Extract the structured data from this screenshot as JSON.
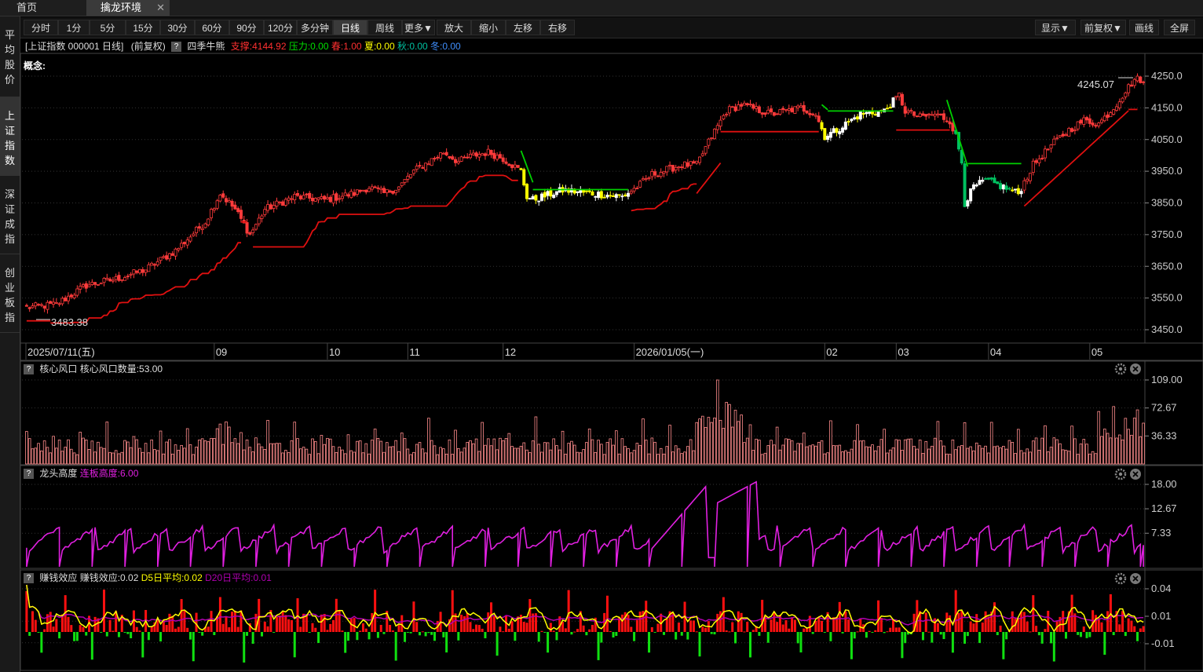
{
  "tabs": {
    "home": "首页",
    "active": "擒龙环境",
    "close": "✕"
  },
  "sidebar": [
    {
      "label": "平均股价",
      "active": false
    },
    {
      "label": "上证指数",
      "active": true
    },
    {
      "label": "深证成指",
      "active": false
    },
    {
      "label": "创业板指",
      "active": false
    }
  ],
  "toolbar": {
    "periods": [
      "分时",
      "1分",
      "5分",
      "15分",
      "30分",
      "60分",
      "90分",
      "120分",
      "多分钟",
      "日线",
      "周线",
      "更多▼",
      "放大",
      "缩小",
      "左移",
      "右移"
    ],
    "active_period": "日线",
    "right": [
      "显示▼",
      "前复权▼",
      "画线",
      "全屏"
    ]
  },
  "info": {
    "title": "[上证指数 000001 日线]",
    "adjust": "(前复权)",
    "indicator": "四季牛熊",
    "support": "支撑:4144.92",
    "pressure": "压力:0.00",
    "spring": "春:1.00",
    "summer": "夏:0.00",
    "autumn": "秋:0.00",
    "winter": "冬:0.00",
    "concept": "概念:",
    "colors": {
      "support": "#ff3030",
      "pressure": "#00e000",
      "spring": "#ff3030",
      "summer": "#ffff00",
      "autumn": "#00c0a0",
      "winter": "#4090ff"
    }
  },
  "main_chart": {
    "price_ticks": [
      "4250.0",
      "4150.0",
      "4050.0",
      "3950.0",
      "3850.0",
      "3750.0",
      "3650.0",
      "3550.0",
      "3450.0"
    ],
    "high_label": "4245.07",
    "low_label": "3483.38",
    "date_labels": [
      "2025/07/11(五)",
      "09",
      "10",
      "11",
      "12",
      "2026/01/05(一)",
      "02",
      "03",
      "04",
      "05"
    ]
  },
  "chart_data": [
    {
      "type": "candlestick",
      "name": "上证指数 日线",
      "ylim": [
        3430,
        4275
      ],
      "yticks": [
        4250,
        4150,
        4050,
        3950,
        3850,
        3750,
        3650,
        3550,
        3450
      ],
      "close_anchors": [
        [
          0,
          3520
        ],
        [
          10,
          3530
        ],
        [
          20,
          3590
        ],
        [
          30,
          3610
        ],
        [
          40,
          3640
        ],
        [
          50,
          3700
        ],
        [
          60,
          3790
        ],
        [
          65,
          3880
        ],
        [
          70,
          3830
        ],
        [
          75,
          3750
        ],
        [
          80,
          3830
        ],
        [
          90,
          3870
        ],
        [
          100,
          3860
        ],
        [
          110,
          3880
        ],
        [
          115,
          3900
        ],
        [
          120,
          3880
        ],
        [
          125,
          3900
        ],
        [
          130,
          3950
        ],
        [
          135,
          3980
        ],
        [
          140,
          4010
        ],
        [
          145,
          3980
        ],
        [
          150,
          4000
        ],
        [
          155,
          4010
        ],
        [
          160,
          3990
        ],
        [
          166,
          3950
        ],
        [
          168,
          3870
        ],
        [
          170,
          3860
        ],
        [
          180,
          3890
        ],
        [
          190,
          3880
        ],
        [
          200,
          3870
        ],
        [
          205,
          3900
        ],
        [
          210,
          3940
        ],
        [
          220,
          3970
        ],
        [
          225,
          3970
        ],
        [
          230,
          4060
        ],
        [
          235,
          4140
        ],
        [
          240,
          4160
        ],
        [
          250,
          4130
        ],
        [
          260,
          4150
        ],
        [
          265,
          4130
        ],
        [
          268,
          4060
        ],
        [
          272,
          4080
        ],
        [
          280,
          4130
        ],
        [
          288,
          4140
        ],
        [
          293,
          4190
        ],
        [
          295,
          4140
        ],
        [
          300,
          4120
        ],
        [
          305,
          4130
        ],
        [
          310,
          4110
        ],
        [
          312,
          4060
        ],
        [
          314,
          3980
        ],
        [
          315,
          3850
        ],
        [
          318,
          3900
        ],
        [
          322,
          3920
        ],
        [
          328,
          3900
        ],
        [
          333,
          3880
        ],
        [
          338,
          3970
        ],
        [
          345,
          4040
        ],
        [
          350,
          4080
        ],
        [
          355,
          4110
        ],
        [
          360,
          4100
        ],
        [
          365,
          4150
        ],
        [
          368,
          4190
        ],
        [
          372,
          4240
        ]
      ],
      "support_line": "red trailing line below price in bull phases; green line above price in bear phases",
      "high": 4245.07,
      "low": 3483.38
    },
    {
      "type": "bar",
      "name": "核心风口 核心风口数量:53.00",
      "ylim": [
        0,
        112
      ],
      "yticks": [
        109.0,
        72.67,
        36.33
      ],
      "last_value": 53.0,
      "color": "#ff8080"
    },
    {
      "type": "area",
      "name": "龙头高度 连板高度:6.00",
      "ylim": [
        0,
        19
      ],
      "yticks": [
        18.0,
        12.67,
        7.33
      ],
      "last_value": 6.0,
      "color": "#e020e0"
    },
    {
      "type": "bar",
      "name": "赚钱效应 赚钱效应:0.02 D5日平均:0.02 D20日平均:0.01",
      "ylim": [
        -0.032,
        0.05
      ],
      "yticks": [
        0.04,
        0.01,
        -0.01
      ],
      "last_values": {
        "value": 0.02,
        "d5": 0.02,
        "d20": 0.01
      }
    }
  ],
  "panels": [
    {
      "name": "核心风口",
      "text": "核心风口数量:53.00",
      "ticks": [
        "109.00",
        "72.67",
        "36.33"
      ]
    },
    {
      "name": "龙头高度",
      "text": "连板高度:6.00",
      "ticks": [
        "18.00",
        "12.67",
        "7.33"
      ]
    },
    {
      "name": "赚钱效应",
      "text": "赚钱效应:0.02",
      "d5": "D5日平均:0.02",
      "d20": "D20日平均:0.01",
      "ticks": [
        "0.04",
        "0.01",
        "-0.01"
      ]
    }
  ],
  "colors": {
    "up": "#ff3b3b",
    "down": "#00c060",
    "support_bull": "#e01010",
    "support_bear": "#00d000",
    "bear_up": "#ffff00",
    "bear_down": "#e8e800",
    "pink": "#ff8c8c",
    "magenta": "#e020e0",
    "d5": "#ffff00",
    "d20": "#b000b0"
  }
}
